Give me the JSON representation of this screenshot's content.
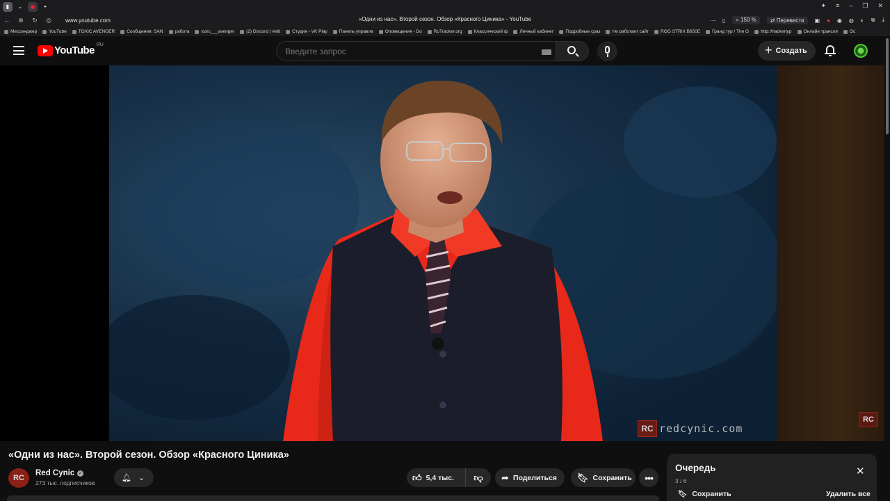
{
  "browser": {
    "window_title": "«Одни из нас». Второй сезон. Обзор «Красного Циника» - YouTube",
    "url": "www.youtube.com",
    "zoom": "150 %",
    "translate_label": "Перевести",
    "bookmarks": [
      "Мессенджер",
      "YouTube",
      "TOXIC AVENGER",
      "Сообщения: SAN",
      "работа",
      "toxic___avenger",
      "(2) Discord | #elit",
      "Студия - VK Play",
      "Панель управле",
      "Оповещения - Do",
      "RuTracker.org",
      "Классический ф",
      "Личный кабинет",
      "Подробные сраз",
      "Не работает сайт",
      "ROG STRIX B650E",
      "Гранд тур / The G",
      "http://hackertyp",
      "Онлайн трансля",
      "Ос"
    ]
  },
  "header": {
    "logo_text": "YouTube",
    "region": "RU",
    "search_placeholder": "Введите запрос",
    "create_label": "Создать"
  },
  "video": {
    "watermark_logo": "RC",
    "watermark_text": "redcynic.com",
    "title": "«Одни из нас». Второй сезон. Обзор «Красного Циника»"
  },
  "channel": {
    "name": "Red Cynic",
    "avatar_text": "RC",
    "subscribers": "273 тыс. подписчиков"
  },
  "actions": {
    "likes": "5,4 тыс.",
    "share": "Поделиться",
    "save": "Сохранить"
  },
  "queue": {
    "title": "Очередь",
    "count": "3 / 6",
    "save": "Сохранить",
    "clear_all": "Удалить все"
  },
  "colors": {
    "brand": "#ff0000",
    "background": "#0f0f0f",
    "button_bg": "#272727"
  }
}
